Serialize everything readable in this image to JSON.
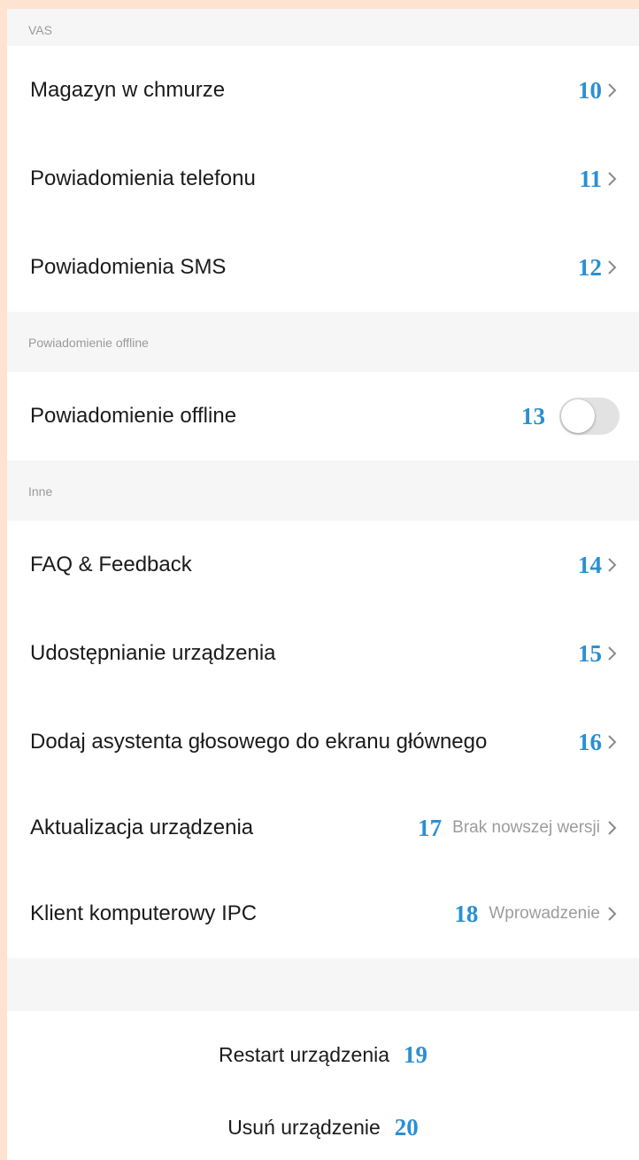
{
  "sections": {
    "vas": {
      "header": "VAS",
      "rows": [
        {
          "label": "Magazyn w chmurze",
          "callout": "10"
        },
        {
          "label": "Powiadomienia telefonu",
          "callout": "11"
        },
        {
          "label": "Powiadomienia SMS",
          "callout": "12"
        }
      ]
    },
    "offline": {
      "header": "Powiadomienie offline",
      "row": {
        "label": "Powiadomienie offline",
        "callout": "13",
        "toggle_on": false
      }
    },
    "other": {
      "header": "Inne",
      "rows": [
        {
          "label": "FAQ & Feedback",
          "callout": "14"
        },
        {
          "label": "Udostępnianie urządzenia",
          "callout": "15"
        },
        {
          "label": "Dodaj asystenta głosowego do ekranu głównego",
          "callout": "16"
        },
        {
          "label": "Aktualizacja urządzenia",
          "callout": "17",
          "value": "Brak nowszej wersji"
        },
        {
          "label": "Klient komputerowy IPC",
          "callout": "18",
          "value": "Wprowadzenie"
        }
      ]
    }
  },
  "actions": {
    "restart": {
      "label": "Restart urządzenia",
      "callout": "19"
    },
    "remove": {
      "label": "Usuń urządzenie",
      "callout": "20"
    }
  },
  "icons": {
    "chevron": "chevron-right-icon",
    "toggle": "toggle-switch"
  },
  "colors": {
    "callout": "#2b8fd3",
    "outer_background": "#fde3d0",
    "section_background": "#f6f6f6"
  }
}
